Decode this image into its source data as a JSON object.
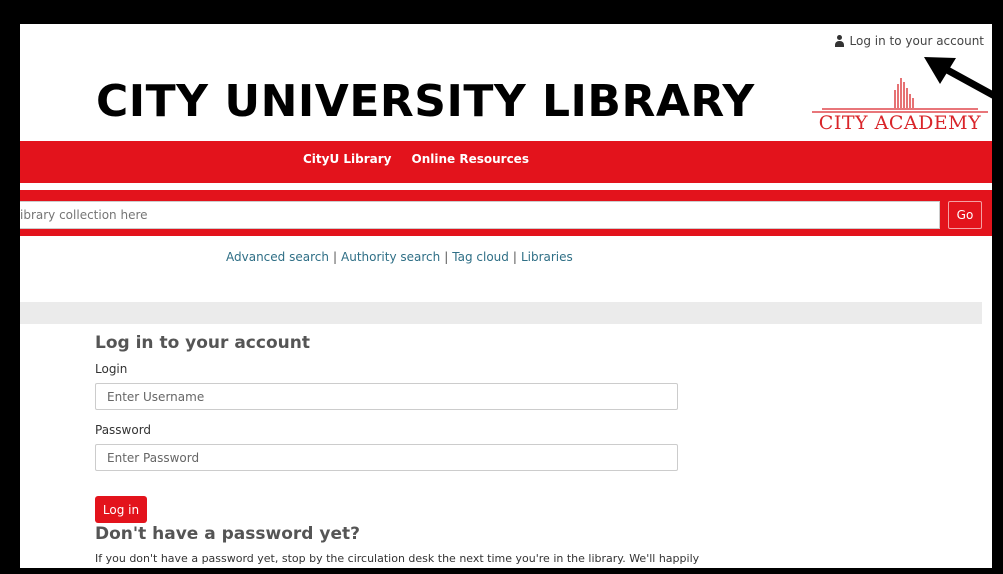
{
  "header": {
    "login_link": "Log in to your account",
    "site_title": "CITY UNIVERSITY LIBRARY",
    "logo_text": "CITY ACADEMY"
  },
  "nav": {
    "items": [
      {
        "label": "CityU Library"
      },
      {
        "label": "Online Resources"
      }
    ]
  },
  "search": {
    "placeholder": "ibrary collection here",
    "go_label": "Go"
  },
  "more_links": {
    "items": [
      "Advanced search",
      "Authority search",
      "Tag cloud",
      "Libraries"
    ],
    "separator": "|"
  },
  "login_form": {
    "heading": "Log in to your account",
    "login_label": "Login",
    "username_placeholder": "Enter Username",
    "password_label": "Password",
    "password_placeholder": "Enter Password",
    "submit_label": "Log in"
  },
  "no_password": {
    "heading": "Don't have a password yet?",
    "text": "If you don't have a password yet, stop by the circulation desk the next time you're in the library. We'll happily"
  },
  "colors": {
    "brand_red": "#e3131c",
    "link_blue": "#2f6f86"
  },
  "icons": {
    "user": "user-icon",
    "annotation": "arrow-annotation-icon"
  }
}
